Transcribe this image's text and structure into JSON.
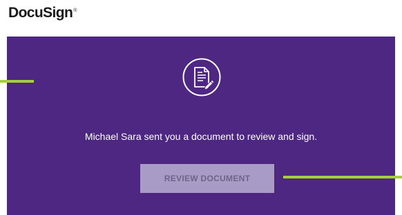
{
  "header": {
    "logo_text": "DocuSign",
    "logo_mark": "®"
  },
  "panel": {
    "icon": "document-pen-icon",
    "message": "Michael Sara sent you a document to review and sign.",
    "review_button_label": "REVIEW DOCUMENT"
  },
  "colors": {
    "panel_background": "#4d2782",
    "button_background": "#a89bc6",
    "button_text": "#6f6487",
    "accent_line": "#a6cf3b"
  }
}
